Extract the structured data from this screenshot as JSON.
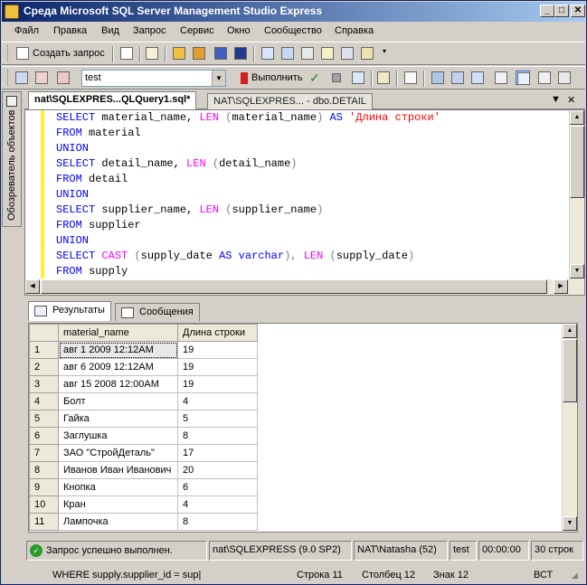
{
  "window": {
    "title": "Среда Microsoft SQL Server Management Studio Express",
    "btn_min": "_",
    "btn_max": "□",
    "btn_close": "✕"
  },
  "menu": [
    "Файл",
    "Правка",
    "Вид",
    "Запрос",
    "Сервис",
    "Окно",
    "Сообщество",
    "Справка"
  ],
  "toolbar1": {
    "new_query_label": "Создать запрос"
  },
  "toolbar2": {
    "database_value": "test",
    "execute_label": "Выполнить"
  },
  "side_panel": {
    "label": "Обозреватель объектов"
  },
  "doc_tabs": {
    "active": "nat\\SQLEXPRES...QLQuery1.sql*",
    "inactive": "NAT\\SQLEXPRES... - dbo.DETAIL",
    "dropdown": "▼",
    "close": "✕"
  },
  "editor": {
    "lines": [
      "SELECT material_name, LEN (material_name) AS 'Длина строки'",
      "FROM material",
      "UNION",
      "SELECT detail_name, LEN (detail_name)",
      "FROM detail",
      "UNION",
      "SELECT supplier_name, LEN (supplier_name)",
      "FROM supplier",
      "UNION",
      "SELECT CAST (supply_date AS varchar), LEN (supply_date)",
      "FROM supply"
    ]
  },
  "results_tabs": {
    "results": "Результаты",
    "messages": "Сообщения"
  },
  "grid": {
    "columns": [
      "material_name",
      "Длина строки"
    ],
    "rows": [
      [
        "1",
        "авг  1 2009 12:12AM",
        "19"
      ],
      [
        "2",
        "авг  6 2009 12:12AM",
        "19"
      ],
      [
        "3",
        "авг 15 2008 12:00AM",
        "19"
      ],
      [
        "4",
        "Болт",
        "4"
      ],
      [
        "5",
        "Гайка",
        "5"
      ],
      [
        "6",
        "Заглушка",
        "8"
      ],
      [
        "7",
        "ЗАО \"СтройДеталь\"",
        "17"
      ],
      [
        "8",
        "Иванов Иван Иванович",
        "20"
      ],
      [
        "9",
        "Кнопка",
        "6"
      ],
      [
        "10",
        "Кран",
        "4"
      ],
      [
        "11",
        "Лампочка",
        "8"
      ]
    ]
  },
  "status": {
    "message": "Запрос успешно выполнен.",
    "server": "nat\\SQLEXPRESS (9.0 SP2)",
    "user": "NAT\\Natasha (52)",
    "database": "test",
    "time": "00:00:00",
    "rows": "30 строк"
  },
  "bottom_bar": {
    "text": "WHERE supply.supplier_id = sup|",
    "line": "Строка 11",
    "col": "Столбец 12",
    "ch": "Знак 12",
    "mode": "ВСТ"
  }
}
